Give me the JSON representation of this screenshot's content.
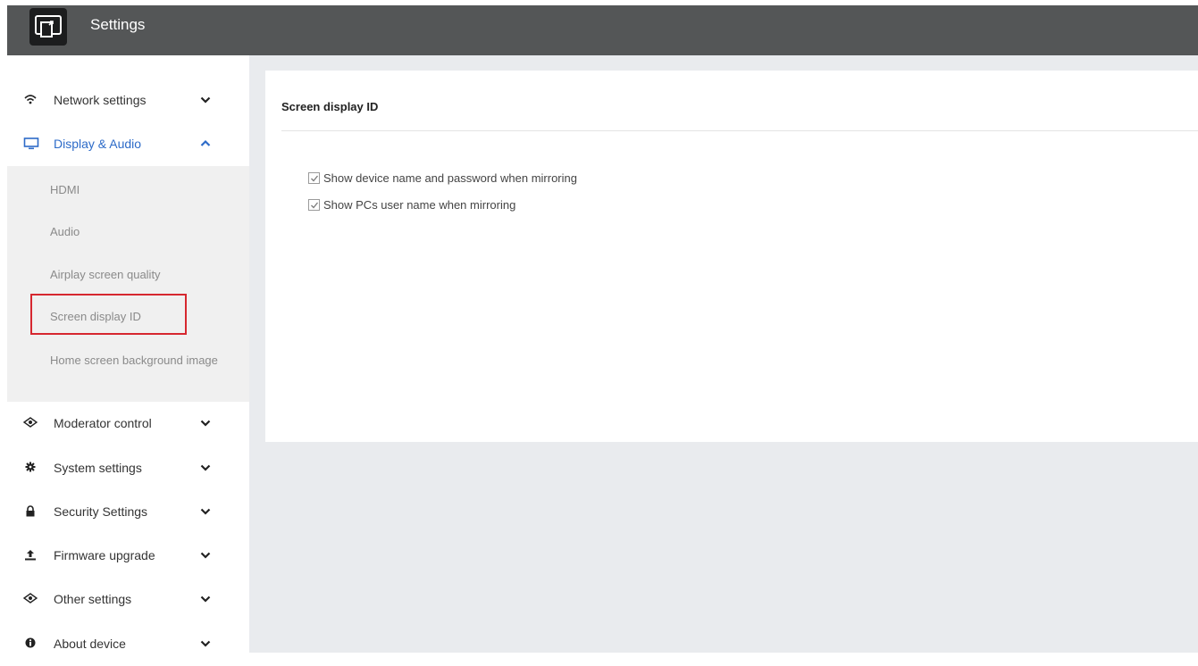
{
  "header": {
    "title": "Settings",
    "logo_icon": "screen-mirror-icon"
  },
  "sidebar": {
    "items": [
      {
        "label": "Network settings",
        "icon": "wifi-icon",
        "expanded": false
      },
      {
        "label": "Display & Audio",
        "icon": "monitor-icon",
        "expanded": true,
        "active": true
      },
      {
        "label": "Moderator control",
        "icon": "eye-icon",
        "expanded": false
      },
      {
        "label": "System settings",
        "icon": "gear-icon",
        "expanded": false
      },
      {
        "label": "Security Settings",
        "icon": "lock-icon",
        "expanded": false
      },
      {
        "label": "Firmware upgrade",
        "icon": "upload-icon",
        "expanded": false
      },
      {
        "label": "Other settings",
        "icon": "eye-icon",
        "expanded": false
      },
      {
        "label": "About device",
        "icon": "info-icon",
        "expanded": false
      }
    ],
    "subitems": [
      {
        "label": "HDMI"
      },
      {
        "label": "Audio"
      },
      {
        "label": "Airplay screen quality"
      },
      {
        "label": "Screen display ID",
        "selected": true
      },
      {
        "label": "Home screen background image"
      }
    ]
  },
  "main": {
    "title": "Screen display ID",
    "options": [
      {
        "label": "Show device name and password when mirroring",
        "checked": true
      },
      {
        "label": "Show PCs user name when mirroring",
        "checked": true
      }
    ]
  },
  "colors": {
    "topbar": "#545657",
    "accent": "#2d6bc8",
    "highlight": "#d6272f",
    "content_bg": "#e9ebee"
  }
}
